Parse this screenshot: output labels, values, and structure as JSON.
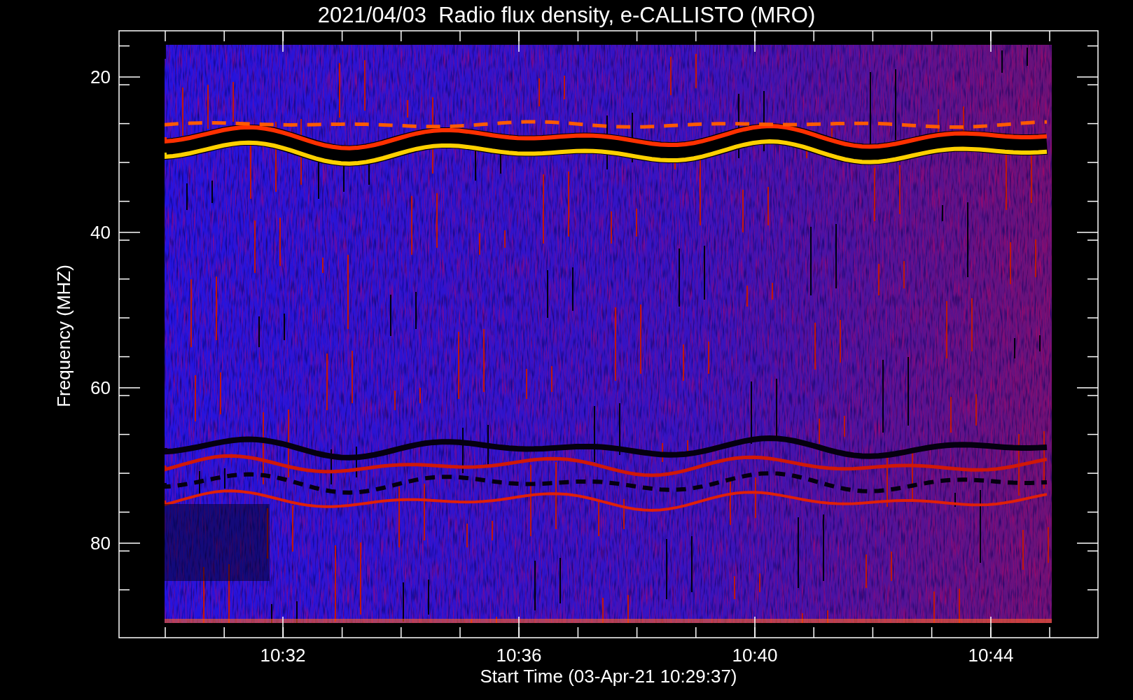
{
  "title": "2021/04/03  Radio flux density, e-CALLISTO (MRO)",
  "y_axis": {
    "label": "Frequency (MHZ)",
    "ticks": [
      "20",
      "40",
      "60",
      "80"
    ]
  },
  "x_axis": {
    "label": "Start Time (03-Apr-21 10:29:37)",
    "ticks": [
      "10:32",
      "10:36",
      "10:40",
      "10:44"
    ]
  }
}
